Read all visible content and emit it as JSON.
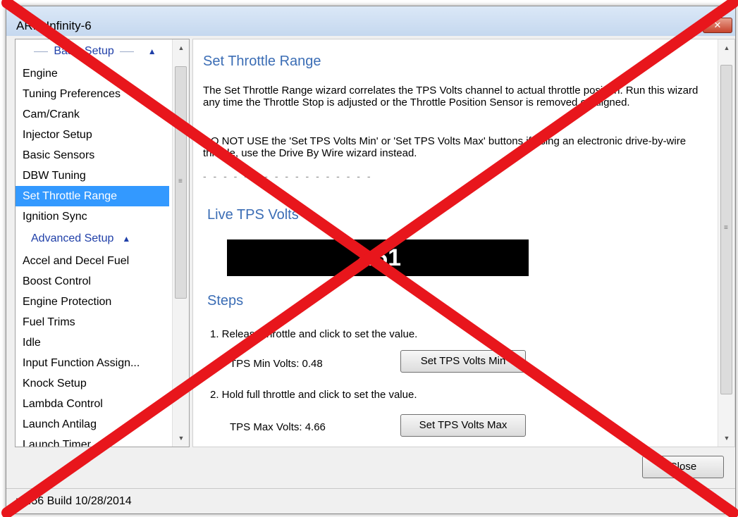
{
  "window": {
    "title": "ARM Infinity-6",
    "close_glyph": "✕"
  },
  "sidebar": {
    "basic_group": "Basic Setup",
    "basic_items": [
      {
        "label": "Engine"
      },
      {
        "label": "Tuning Preferences"
      },
      {
        "label": "Cam/Crank"
      },
      {
        "label": "Injector Setup"
      },
      {
        "label": "Basic Sensors"
      },
      {
        "label": "DBW Tuning"
      },
      {
        "label": "Set Throttle Range",
        "selected": true
      },
      {
        "label": "Ignition Sync"
      }
    ],
    "advanced_group": "Advanced Setup",
    "advanced_items": [
      {
        "label": "Accel and Decel Fuel"
      },
      {
        "label": "Boost Control"
      },
      {
        "label": "Engine Protection"
      },
      {
        "label": "Fuel Trims"
      },
      {
        "label": "Idle"
      },
      {
        "label": "Input Function Assign..."
      },
      {
        "label": "Knock Setup"
      },
      {
        "label": "Lambda Control"
      },
      {
        "label": "Launch Antilag"
      },
      {
        "label": "Launch Timer"
      }
    ]
  },
  "content": {
    "title": "Set Throttle Range",
    "description": "The Set Throttle Range wizard correlates the TPS Volts channel to actual throttle position. Run this wizard any time the Throttle Stop is adjusted or the Throttle Position Sensor is removed or aligned.",
    "warning": "DO NOT USE the 'Set TPS Volts Min' or 'Set TPS Volts Max' buttons if using an electronic drive-by-wire throttle, use the Drive By Wire wizard instead.",
    "dashes": "- - - - - - - - - - - - - - - - -",
    "live_title": "Live TPS Volts",
    "live_value": "2.61",
    "steps_title": "Steps",
    "step1": "1. Release throttle and click to set the value.",
    "min_label": "TPS Min Volts: 0.48",
    "min_button": "Set TPS Volts Min",
    "step2": "2. Hold full throttle and click to set the value.",
    "max_label": "TPS Max Volts: 4.66",
    "max_button": "Set TPS Volts Max"
  },
  "footer": {
    "close_button": "Close",
    "status": "v1.56 Build 10/28/2014"
  },
  "overlay": {
    "color": "#e8161c"
  }
}
